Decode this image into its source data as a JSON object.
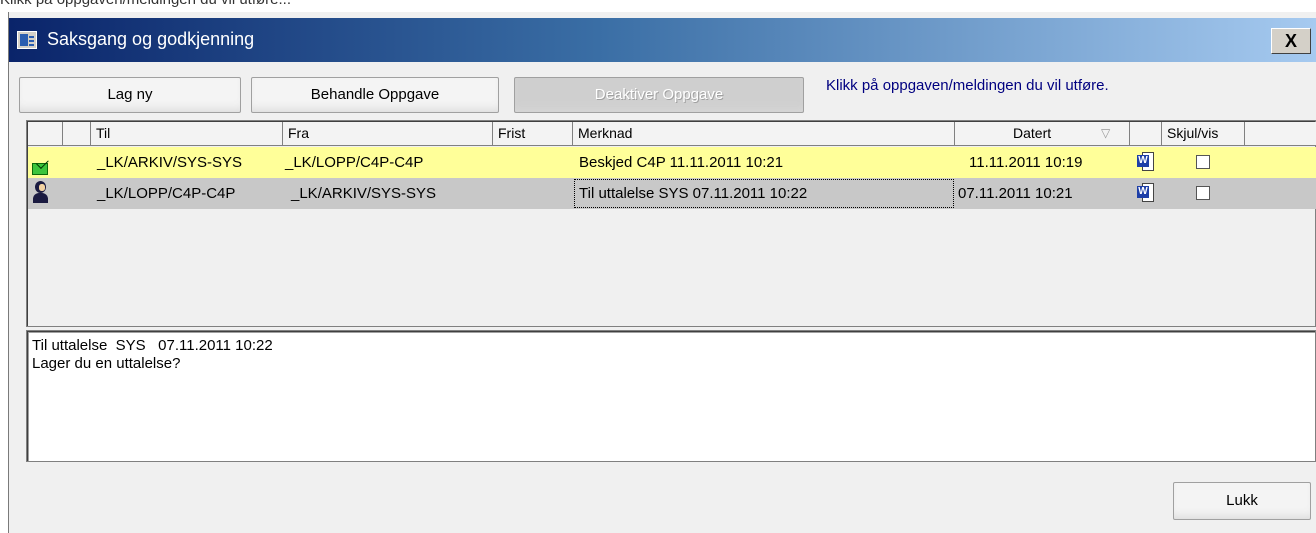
{
  "top_strip_text": "Klikk på oppgaven/meldingen du vil utføre...",
  "window": {
    "title": "Saksgang og godkjenning",
    "close_label": "X"
  },
  "toolbar": {
    "new_label": "Lag ny",
    "process_label": "Behandle Oppgave",
    "deactivate_label": "Deaktiver Oppgave",
    "hint": "Klikk på oppgaven/meldingen du vil  utføre."
  },
  "grid": {
    "columns": [
      "Til",
      "Fra",
      "Frist",
      "Merknad",
      "Datert",
      "Skjul/vis"
    ],
    "sort_indicator": "▽",
    "rows": [
      {
        "icon": "mail-icon",
        "til": "_LK/ARKIV/SYS-SYS",
        "fra": "_LK/LOPP/C4P-C4P",
        "frist": "",
        "merknad": "Beskjed   C4P   11.11.2011 10:21",
        "datert": "11.11.2011 10:19",
        "doc_icon": "word-document-icon",
        "hidden": false,
        "color": "#ffff99"
      },
      {
        "icon": "person-icon",
        "til": "_LK/LOPP/C4P-C4P",
        "fra": "_LK/ARKIV/SYS-SYS",
        "frist": "",
        "merknad": "Til uttalelse  SYS   07.11.2011 10:22",
        "datert": "07.11.2011 10:21",
        "doc_icon": "word-document-icon",
        "hidden": false,
        "color": "#c8c8c8"
      }
    ]
  },
  "details": {
    "line1": "Til uttalelse  SYS   07.11.2011 10:22",
    "line2": "Lager du en uttalelse?"
  },
  "footer": {
    "close_label": "Lukk"
  }
}
